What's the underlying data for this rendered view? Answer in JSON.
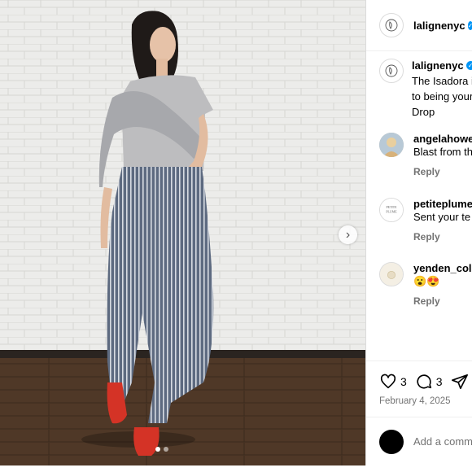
{
  "post": {
    "next_icon": "chevron-right-icon",
    "carousel": {
      "count": 2,
      "active": 1
    }
  },
  "header": {
    "username": "lalignenyc",
    "verified": true
  },
  "caption": {
    "username": "lalignenyc",
    "lines": [
      "The Isadora i",
      "to being your",
      "Drop"
    ]
  },
  "comments": [
    {
      "username": "angelahowe",
      "text": "Blast from th",
      "reply": "Reply"
    },
    {
      "username": "petiteplume",
      "text": "Sent your te",
      "reply": "Reply",
      "avatar_text": "PETITE PLUME"
    },
    {
      "username": "yenden_col",
      "text": "😮😍",
      "reply": "Reply"
    }
  ],
  "actions": {
    "likes": "3",
    "comments": "3",
    "date": "February 4, 2025"
  },
  "add_comment": {
    "placeholder": "Add a comm"
  },
  "colors": {
    "verified": "#0095f6",
    "muted": "#737373",
    "divider": "#dbdbdb"
  }
}
